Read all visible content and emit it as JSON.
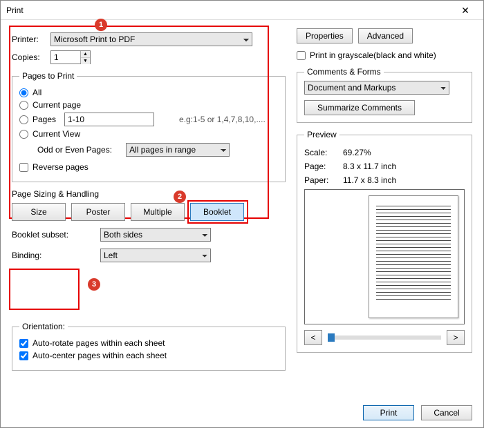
{
  "title": "Print",
  "printer": {
    "label": "Printer:",
    "value": "Microsoft Print to PDF"
  },
  "copies": {
    "label": "Copies:",
    "value": "1"
  },
  "buttons": {
    "properties": "Properties",
    "advanced": "Advanced",
    "summarize": "Summarize Comments",
    "print": "Print",
    "cancel": "Cancel"
  },
  "grayscale": {
    "label": "Print in grayscale(black and white)",
    "checked": false
  },
  "pagesToPrint": {
    "legend": "Pages to Print",
    "all": "All",
    "current": "Current page",
    "pages": "Pages",
    "pagesValue": "1-10",
    "pagesHint": "e.g:1-5 or 1,4,7,8,10,....",
    "view": "Current View",
    "oddEvenLabel": "Odd or Even Pages:",
    "oddEvenValue": "All pages in range",
    "reverse": "Reverse pages"
  },
  "sizing": {
    "title": "Page Sizing & Handling",
    "tabs": {
      "size": "Size",
      "poster": "Poster",
      "multiple": "Multiple",
      "booklet": "Booklet"
    },
    "bookletSubsetLabel": "Booklet subset:",
    "bookletSubsetValue": "Both sides",
    "bindingLabel": "Binding:",
    "bindingValue": "Left"
  },
  "orientation": {
    "legend": "Orientation:",
    "autorotate": "Auto-rotate pages within each sheet",
    "autocenter": "Auto-center pages within each sheet"
  },
  "comments": {
    "legend": "Comments & Forms",
    "value": "Document and Markups"
  },
  "preview": {
    "legend": "Preview",
    "scaleLabel": "Scale:",
    "scaleValue": "69.27%",
    "pageLabel": "Page:",
    "pageValue": "8.3 x 11.7 inch",
    "paperLabel": "Paper:",
    "paperValue": "11.7 x 8.3 inch",
    "prev": "<",
    "next": ">"
  },
  "annotations": {
    "b1": "1",
    "b2": "2",
    "b3": "3"
  }
}
